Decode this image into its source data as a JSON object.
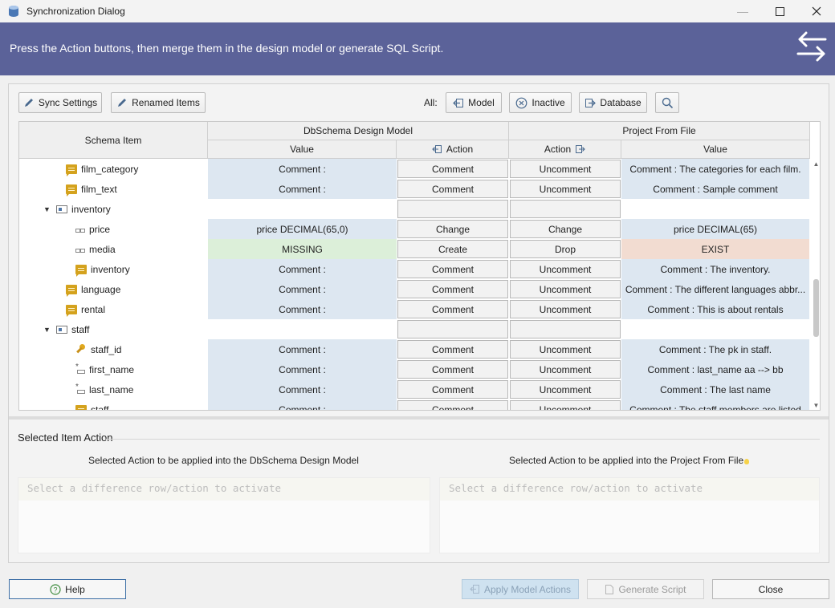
{
  "window": {
    "title": "Synchronization Dialog"
  },
  "banner": {
    "text": "Press the Action buttons, then merge them in the design model or generate SQL Script."
  },
  "toolbar": {
    "sync_settings": "Sync Settings",
    "renamed_items": "Renamed Items",
    "all_label": "All:",
    "model": "Model",
    "inactive": "Inactive",
    "database": "Database"
  },
  "grid": {
    "headers": {
      "schema_item": "Schema Item",
      "left_group": "DbSchema Design Model",
      "right_group": "Project From File",
      "value": "Value",
      "action": "Action"
    },
    "rows": [
      {
        "indent": 1,
        "caret": "",
        "icon": "comment",
        "name": "film_category",
        "left_value": "Comment :",
        "left_style": "blue",
        "left_action": "Comment",
        "right_action": "Uncomment",
        "right_value": "Comment : The categories for each film.",
        "right_style": "blue"
      },
      {
        "indent": 1,
        "caret": "",
        "icon": "comment",
        "name": "film_text",
        "left_value": "Comment :",
        "left_style": "blue",
        "left_action": "Comment",
        "right_action": "Uncomment",
        "right_value": "Comment : Sample comment",
        "right_style": "blue"
      },
      {
        "indent": 0,
        "caret": "▼",
        "icon": "table",
        "name": "inventory",
        "left_value": "",
        "left_style": "",
        "left_action": "",
        "right_action": "",
        "right_value": "",
        "right_style": ""
      },
      {
        "indent": 2,
        "caret": "",
        "icon": "column",
        "name": "price",
        "left_value": "price DECIMAL(65,0)",
        "left_style": "blue",
        "left_action": "Change",
        "right_action": "Change",
        "right_value": "price DECIMAL(65)",
        "right_style": "blue"
      },
      {
        "indent": 2,
        "caret": "",
        "icon": "column",
        "name": "media",
        "left_value": "MISSING",
        "left_style": "green",
        "left_action": "Create",
        "right_action": "Drop",
        "right_value": "EXIST",
        "right_style": "peach"
      },
      {
        "indent": 2,
        "caret": "",
        "icon": "comment",
        "name": "inventory",
        "left_value": "Comment :",
        "left_style": "blue",
        "left_action": "Comment",
        "right_action": "Uncomment",
        "right_value": "Comment : The inventory.",
        "right_style": "blue"
      },
      {
        "indent": 1,
        "caret": "",
        "icon": "comment",
        "name": "language",
        "left_value": "Comment :",
        "left_style": "blue",
        "left_action": "Comment",
        "right_action": "Uncomment",
        "right_value": "Comment : The different languages abbr...",
        "right_style": "blue"
      },
      {
        "indent": 1,
        "caret": "",
        "icon": "comment",
        "name": "rental",
        "left_value": "Comment :",
        "left_style": "blue",
        "left_action": "Comment",
        "right_action": "Uncomment",
        "right_value": "Comment : This is about rentals",
        "right_style": "blue"
      },
      {
        "indent": 0,
        "caret": "▼",
        "icon": "table",
        "name": "staff",
        "left_value": "",
        "left_style": "",
        "left_action": "",
        "right_action": "",
        "right_value": "",
        "right_style": ""
      },
      {
        "indent": 2,
        "caret": "",
        "icon": "key",
        "name": "staff_id",
        "left_value": "Comment :",
        "left_style": "blue",
        "left_action": "Comment",
        "right_action": "Uncomment",
        "right_value": "Comment : The pk in staff.",
        "right_style": "blue"
      },
      {
        "indent": 2,
        "caret": "",
        "icon": "notnull",
        "name": "first_name",
        "left_value": "Comment :",
        "left_style": "blue",
        "left_action": "Comment",
        "right_action": "Uncomment",
        "right_value": "Comment : last_name aa --> bb",
        "right_style": "blue"
      },
      {
        "indent": 2,
        "caret": "",
        "icon": "notnull",
        "name": "last_name",
        "left_value": "Comment :",
        "left_style": "blue",
        "left_action": "Comment",
        "right_action": "Uncomment",
        "right_value": "Comment : The last name",
        "right_style": "blue"
      },
      {
        "indent": 2,
        "caret": "",
        "icon": "comment",
        "name": "staff",
        "left_value": "Comment :",
        "left_style": "blue",
        "left_action": "Comment",
        "right_action": "Uncomment",
        "right_value": "Comment : The staff members are listed",
        "right_style": "blue"
      }
    ]
  },
  "selected": {
    "title": "Selected Item Action",
    "left_label": "Selected Action to be applied into the DbSchema Design Model",
    "right_label": "Selected Action to be applied into the Project From File",
    "left_placeholder": "Select a difference row/action to activate",
    "right_placeholder": "Select a difference row/action to activate"
  },
  "footer": {
    "help": "Help",
    "apply": "Apply Model Actions",
    "generate": "Generate Script",
    "close": "Close"
  }
}
